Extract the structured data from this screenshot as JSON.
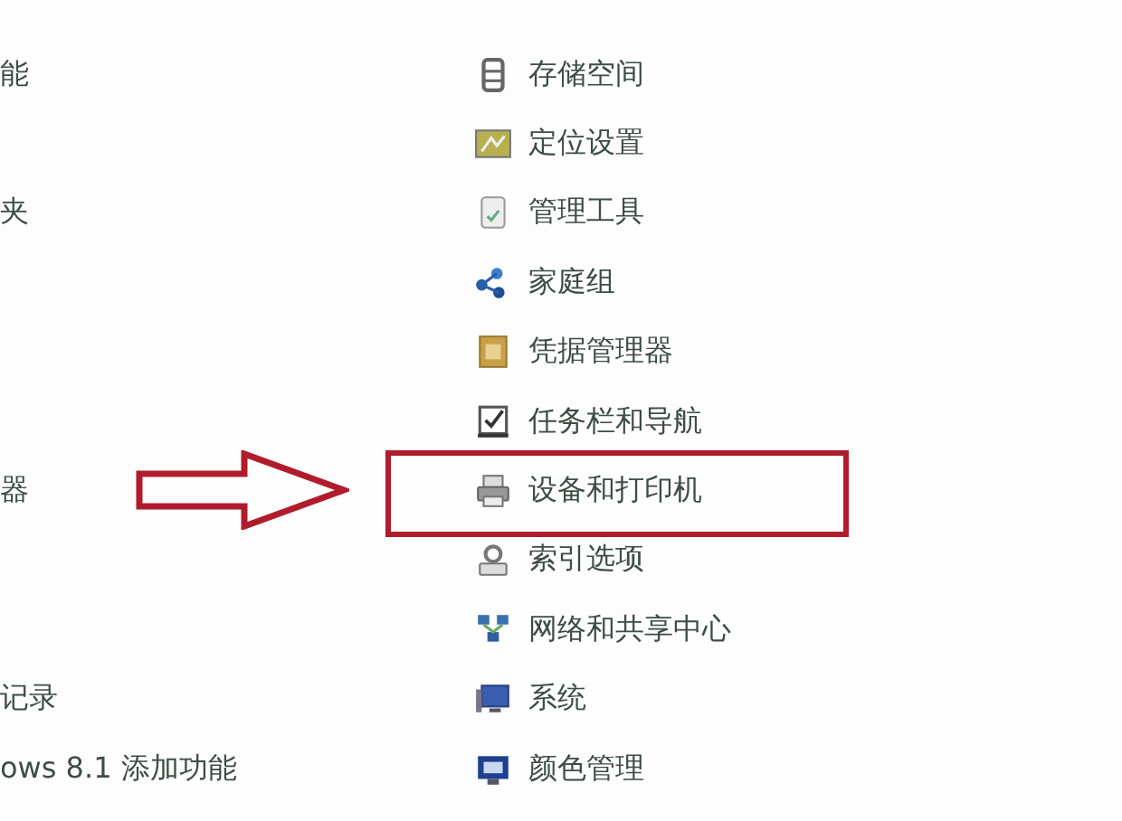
{
  "rows": [
    {
      "left": "能",
      "right": {
        "label": "存储空间",
        "kind": "storage",
        "highlighted": false
      }
    },
    {
      "right": {
        "label": "定位设置",
        "kind": "location",
        "highlighted": false
      }
    },
    {
      "left": "夹",
      "right": {
        "label": "管理工具",
        "kind": "admin-tools",
        "highlighted": false
      }
    },
    {
      "right": {
        "label": "家庭组",
        "kind": "homegroup",
        "highlighted": false
      }
    },
    {
      "right": {
        "label": "凭据管理器",
        "kind": "credential",
        "highlighted": false
      }
    },
    {
      "right": {
        "label": "任务栏和导航",
        "kind": "taskbar",
        "highlighted": false
      }
    },
    {
      "left": "器",
      "right": {
        "label": "设备和打印机",
        "kind": "printer",
        "highlighted": true
      }
    },
    {
      "right": {
        "label": "索引选项",
        "kind": "indexing",
        "highlighted": false
      }
    },
    {
      "right": {
        "label": "网络和共享中心",
        "kind": "network",
        "highlighted": false
      }
    },
    {
      "left": "记录",
      "right": {
        "label": "系统",
        "kind": "system",
        "highlighted": false
      }
    },
    {
      "left": "ows 8.1 添加功能",
      "right": {
        "label": "颜色管理",
        "kind": "color",
        "highlighted": false
      }
    }
  ]
}
